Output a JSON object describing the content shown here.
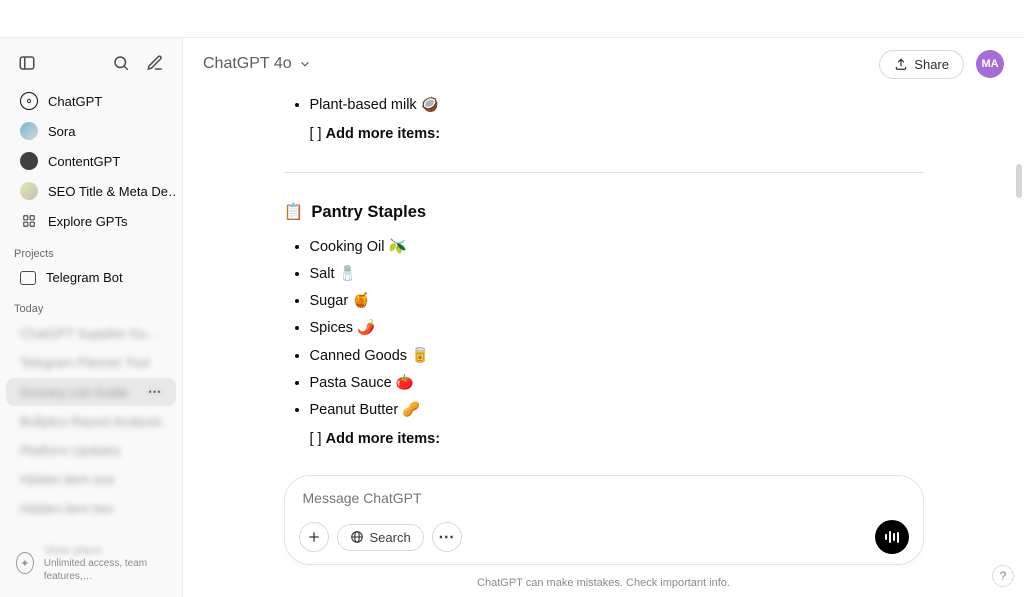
{
  "header": {
    "model_label": "ChatGPT 4o",
    "share_label": "Share",
    "avatar_initials": "MA"
  },
  "sidebar": {
    "nav": [
      {
        "label": "ChatGPT",
        "icon": "chatgpt"
      },
      {
        "label": "Sora",
        "icon": "sora"
      },
      {
        "label": "ContentGPT",
        "icon": "content"
      },
      {
        "label": "SEO Title & Meta De…",
        "icon": "seo"
      },
      {
        "label": "Explore GPTs",
        "icon": "grid"
      }
    ],
    "projects_label": "Projects",
    "projects": [
      {
        "label": "Telegram Bot"
      }
    ],
    "today_label": "Today",
    "chats": [
      {
        "label": "ChatGPT Supplier Guide",
        "blurred": true
      },
      {
        "label": "Telegram Planner Tool",
        "blurred": true
      },
      {
        "label": "Grocery List Guide",
        "blurred": true,
        "active": true
      },
      {
        "label": "Bollytics Report Analysis",
        "blurred": true
      },
      {
        "label": "Platform Updates",
        "blurred": true
      },
      {
        "label": "Hidden item one",
        "blurred": true
      },
      {
        "label": "Hidden item two",
        "blurred": true
      }
    ],
    "upgrade_title": "View plans",
    "upgrade_sub": "Unlimited access, team features,…"
  },
  "content": {
    "top_items": [
      "Plant-based milk 🥥"
    ],
    "add_more_prefix": "[ ] ",
    "add_more_label": "Add more items:",
    "pantry_heading": "Pantry Staples",
    "pantry_icon": "📋",
    "pantry_items": [
      "Cooking Oil 🫒",
      "Salt 🧂",
      "Sugar 🍯",
      "Spices 🌶️",
      "Canned Goods 🥫",
      "Pasta Sauce 🍅",
      "Peanut Butter 🥜"
    ]
  },
  "composer": {
    "placeholder": "Message ChatGPT",
    "search_label": "Search"
  },
  "footer": {
    "disclaimer": "ChatGPT can make mistakes. Check important info."
  }
}
